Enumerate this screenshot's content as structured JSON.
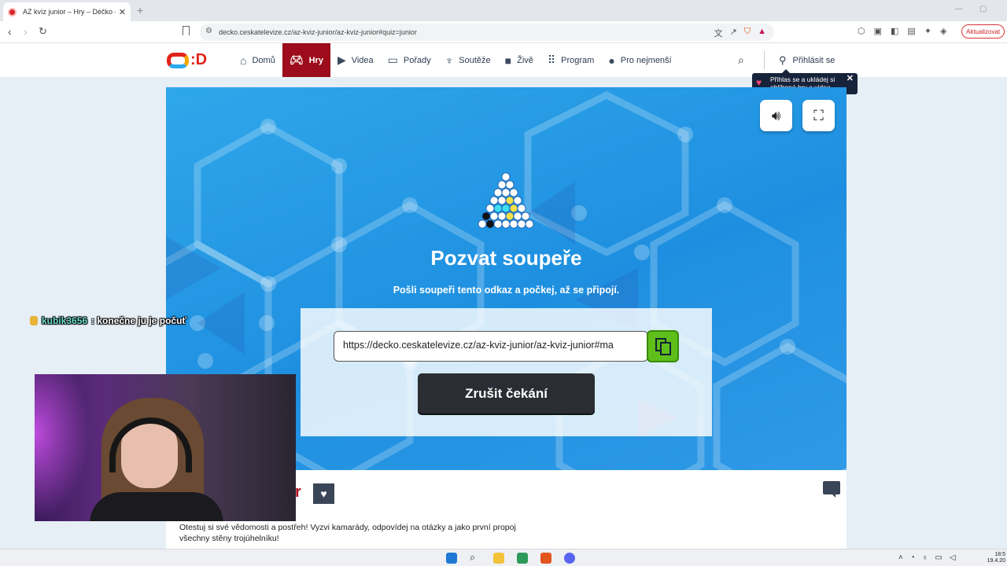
{
  "browser": {
    "tab_title": "AZ kvíz junior – Hry – Déčko – Č",
    "tab_close": "✕",
    "new_tab": "+",
    "url": "decko.ceskatelevize.cz/az-kviz-junior/az-kviz-junior#quiz=junior",
    "update_label": "Aktualizovat"
  },
  "site": {
    "logo_text": ":D",
    "nav": [
      {
        "label": "Domů",
        "icon": "home-icon"
      },
      {
        "label": "Hry",
        "icon": "gamepad-icon",
        "active": true
      },
      {
        "label": "Videa",
        "icon": "play-icon"
      },
      {
        "label": "Pořady",
        "icon": "tv-icon"
      },
      {
        "label": "Soutěže",
        "icon": "trophy-icon"
      },
      {
        "label": "Živě",
        "icon": "camera-icon"
      },
      {
        "label": "Program",
        "icon": "grid-icon"
      },
      {
        "label": "Pro nejmenší",
        "icon": "ball-icon"
      }
    ],
    "login_label": "Přihlásit se",
    "tooltip_text": "Přihlas se a ukládej si oblíbené hry a videa."
  },
  "game": {
    "title": "Pozvat soupeře",
    "subtitle": "Pošli soupeři tento odkaz a počkej, až se připojí.",
    "invite_link": "https://decko.ceskatelevize.cz/az-kviz-junior/az-kviz-junior#ma",
    "cancel_label": "Zrušit čekání"
  },
  "below": {
    "title_fragment": "r",
    "description": "Otestuj si své vědomosti a postřeh! Vyzvi kamarády, odpovídej na otázky a jako první propoj všechny stěny trojúhelníku!"
  },
  "chat": {
    "user": "kubik3656",
    "message": ": konečne ju je počuť"
  },
  "taskbar": {
    "time": "18:5",
    "date": "19.4.20"
  },
  "colors": {
    "accent_red": "#9c0c1a",
    "game_blue": "#2fa7ea",
    "copy_green": "#5fbf1a",
    "button_dark": "#2a2d33"
  }
}
